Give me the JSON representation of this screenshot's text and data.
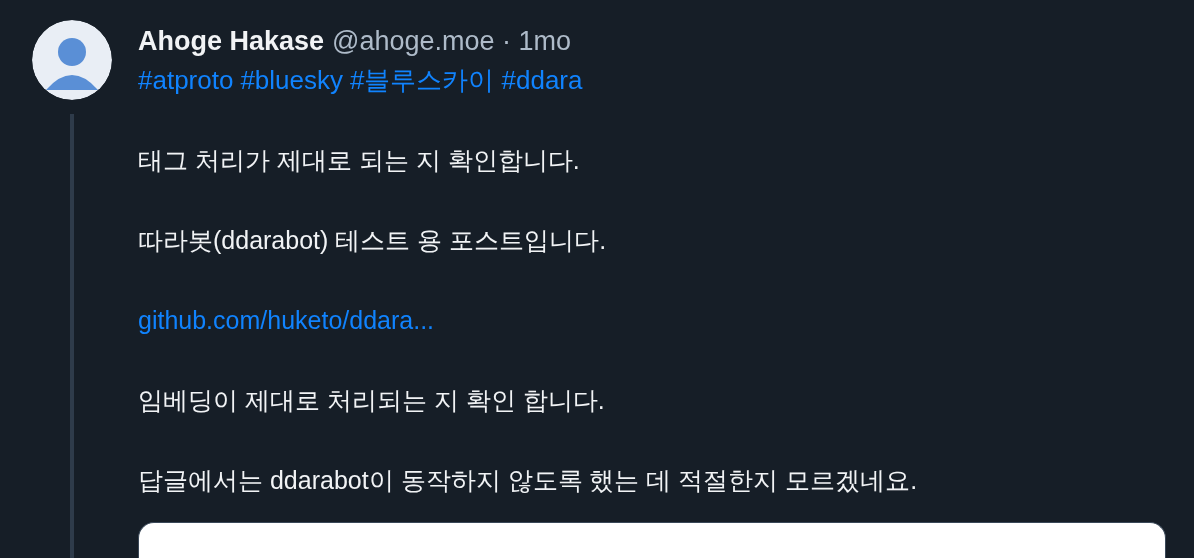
{
  "post": {
    "author": {
      "name": "Ahoge Hakase",
      "meta": "@ahoge.moe · 1mo"
    },
    "tags": [
      "#atproto",
      "#bluesky",
      "#블루스카이",
      "#ddara"
    ],
    "paragraphs": [
      {
        "kind": "text",
        "text": "태그 처리가 제대로 되는 지 확인합니다."
      },
      {
        "kind": "text",
        "text": "따라봇(ddarabot) 테스트 용 포스트입니다."
      },
      {
        "kind": "link",
        "text": "github.com/huketo/ddara..."
      },
      {
        "kind": "text",
        "text": "임베딩이 제대로 처리되는 지 확인 합니다."
      },
      {
        "kind": "text",
        "text": "답글에서는 ddarabot이 동작하지 않도록 했는 데 적절한지 모르겠네요."
      }
    ],
    "embed": {
      "kind": "card"
    }
  }
}
